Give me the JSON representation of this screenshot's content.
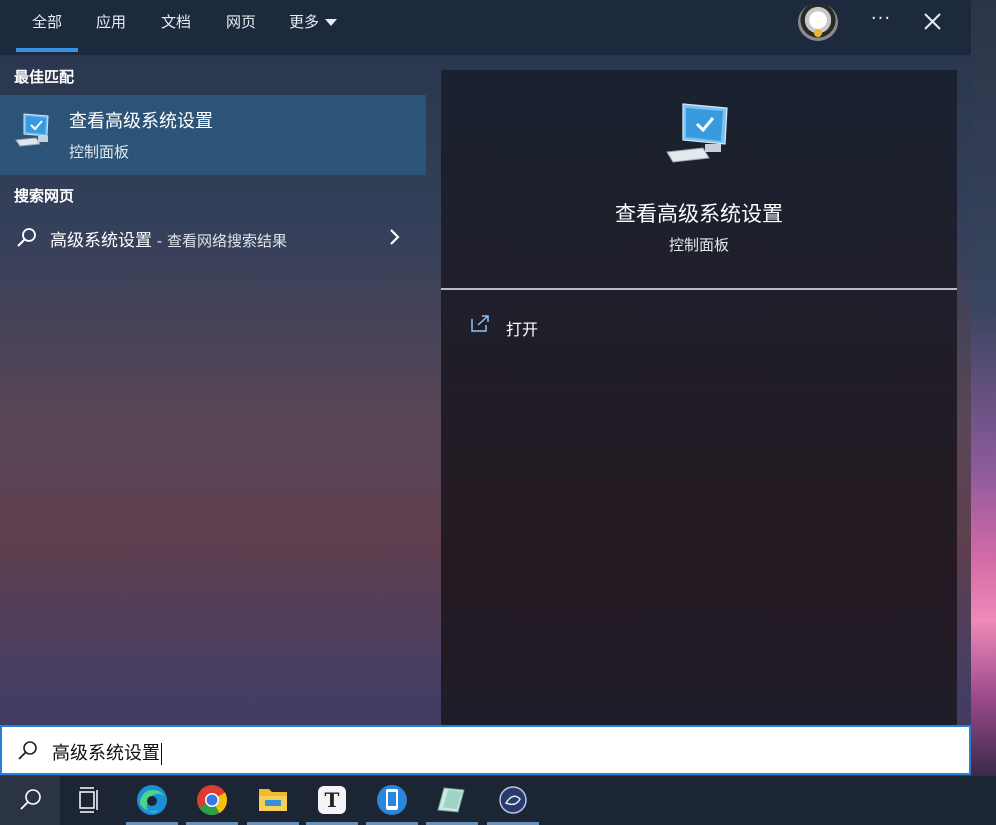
{
  "tabs": [
    {
      "label": "全部",
      "active": true
    },
    {
      "label": "应用",
      "active": false
    },
    {
      "label": "文档",
      "active": false
    },
    {
      "label": "网页",
      "active": false
    },
    {
      "label": "更多",
      "active": false
    }
  ],
  "header": {
    "more_icon": "ellipsis-icon",
    "close_icon": "close-icon"
  },
  "best_match": {
    "heading": "最佳匹配",
    "title": "查看高级系统设置",
    "subtitle": "控制面板",
    "icon": "computer-check-icon"
  },
  "web_search": {
    "heading": "搜索网页",
    "query": "高级系统设置",
    "hint": " - 查看网络搜索结果"
  },
  "preview": {
    "title": "查看高级系统设置",
    "subtitle": "控制面板",
    "actions": [
      {
        "label": "打开",
        "icon": "open-external-icon"
      }
    ]
  },
  "search": {
    "value": "高级系统设置"
  },
  "taskbar": {
    "items": [
      "search-icon",
      "task-view-icon",
      "edge-icon",
      "chrome-icon",
      "file-explorer-icon",
      "typora-icon",
      "phone-icon",
      "notes-icon",
      "app-icon"
    ]
  },
  "colors": {
    "accent": "#3b8fe0",
    "selection": "#2c5478",
    "topbar": "#1d2a3e",
    "taskbar": "#1c2533"
  }
}
